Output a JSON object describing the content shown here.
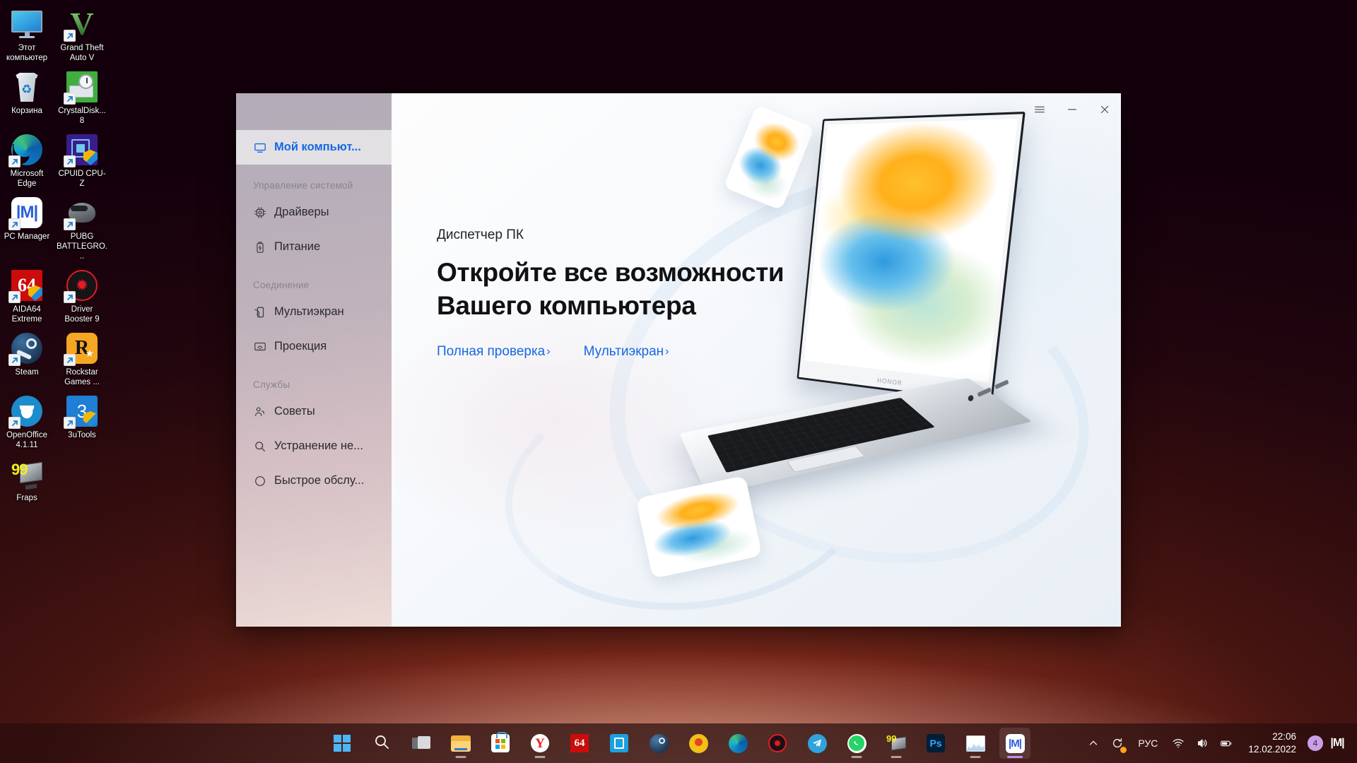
{
  "desktop": {
    "icons": [
      {
        "label": "Этот компьютер",
        "icon": "this-pc-icon",
        "shortcut": false,
        "art": "monitor"
      },
      {
        "label": "Grand Theft Auto V",
        "icon": "gta-v-icon",
        "shortcut": true,
        "art": "gtav"
      },
      {
        "label": "Корзина",
        "icon": "recycle-bin-icon",
        "shortcut": false,
        "art": "bin"
      },
      {
        "label": "CrystalDisk... 8",
        "icon": "crystaldiskmark-icon",
        "shortcut": true,
        "art": "crystal"
      },
      {
        "label": "Microsoft Edge",
        "icon": "microsoft-edge-icon",
        "shortcut": true,
        "art": "edge"
      },
      {
        "label": "CPUID CPU-Z",
        "icon": "cpu-z-icon",
        "shortcut": true,
        "art": "cpuz"
      },
      {
        "label": "PC Manager",
        "icon": "pc-manager-icon",
        "shortcut": true,
        "art": "pcm"
      },
      {
        "label": "PUBG BATTLEGRO...",
        "icon": "pubg-icon",
        "shortcut": true,
        "art": "pubg"
      },
      {
        "label": "AIDA64 Extreme",
        "icon": "aida64-icon",
        "shortcut": true,
        "art": "aida"
      },
      {
        "label": "Driver Booster 9",
        "icon": "driver-booster-icon",
        "shortcut": true,
        "art": "driver"
      },
      {
        "label": "Steam",
        "icon": "steam-icon",
        "shortcut": true,
        "art": "steam"
      },
      {
        "label": "Rockstar Games ...",
        "icon": "rockstar-games-icon",
        "shortcut": true,
        "art": "rockstar"
      },
      {
        "label": "OpenOffice 4.1.11",
        "icon": "openoffice-icon",
        "shortcut": true,
        "art": "openoffice"
      },
      {
        "label": "3uTools",
        "icon": "3utools-icon",
        "shortcut": true,
        "art": "3utools"
      },
      {
        "label": "Fraps",
        "icon": "fraps-icon",
        "shortcut": false,
        "art": "fraps"
      }
    ]
  },
  "window": {
    "title_controls": {
      "menu_label": "Меню",
      "minimize_label": "Свернуть",
      "close_label": "Закрыть"
    },
    "sidebar": {
      "primary": {
        "label": "Мой компьют...",
        "icon": "monitor-icon",
        "active": true
      },
      "sections": [
        {
          "title": "Управление системой",
          "items": [
            {
              "label": "Драйверы",
              "icon": "chip-icon"
            },
            {
              "label": "Питание",
              "icon": "battery-icon"
            }
          ]
        },
        {
          "title": "Соединение",
          "items": [
            {
              "label": "Мультиэкран",
              "icon": "multiscreen-icon"
            },
            {
              "label": "Проекция",
              "icon": "projection-icon"
            }
          ]
        },
        {
          "title": "Службы",
          "items": [
            {
              "label": "Советы",
              "icon": "tips-icon"
            },
            {
              "label": "Устранение не...",
              "icon": "search-icon"
            },
            {
              "label": "Быстрое обслу...",
              "icon": "shield-icon"
            }
          ]
        }
      ]
    },
    "hero": {
      "eyebrow": "Диспетчер ПК",
      "headline_line1": "Откройте все возможности",
      "headline_line2": "Вашего компьютера",
      "links": [
        {
          "label": "Полная проверка",
          "chevron": "›"
        },
        {
          "label": "Мультиэкран",
          "chevron": "›"
        }
      ]
    },
    "accent_color": "#1668e3"
  },
  "taskbar": {
    "items": [
      {
        "name": "start-button",
        "art": "win",
        "running": false,
        "focused": false
      },
      {
        "name": "search-button",
        "art": "search",
        "running": false,
        "focused": false
      },
      {
        "name": "task-view-button",
        "art": "taskview",
        "running": false,
        "focused": false
      },
      {
        "name": "file-explorer",
        "art": "folder",
        "running": true,
        "focused": false
      },
      {
        "name": "microsoft-store",
        "art": "store",
        "running": false,
        "focused": false
      },
      {
        "name": "yandex-browser",
        "art": "yandex",
        "running": true,
        "focused": false
      },
      {
        "name": "aida64",
        "art": "aida",
        "running": false,
        "focused": false
      },
      {
        "name": "clipboard-app",
        "art": "blue",
        "running": false,
        "focused": false
      },
      {
        "name": "steam",
        "art": "steam",
        "running": false,
        "focused": false
      },
      {
        "name": "music-player",
        "art": "music",
        "running": false,
        "focused": false
      },
      {
        "name": "microsoft-edge",
        "art": "edge",
        "running": false,
        "focused": false
      },
      {
        "name": "driver-booster",
        "art": "driver",
        "running": false,
        "focused": false
      },
      {
        "name": "telegram",
        "art": "telegram",
        "running": false,
        "focused": false
      },
      {
        "name": "whatsapp",
        "art": "whatsapp",
        "running": true,
        "focused": false
      },
      {
        "name": "fraps",
        "art": "fraps",
        "running": true,
        "focused": false
      },
      {
        "name": "photoshop",
        "art": "photoshop",
        "running": false,
        "focused": false
      },
      {
        "name": "hwmonitor",
        "art": "chart",
        "running": true,
        "focused": false
      },
      {
        "name": "pc-manager",
        "art": "pcm",
        "running": true,
        "focused": true
      }
    ],
    "tray": {
      "chevron_icon": "chevron-up-icon",
      "update_icon": "update-icon",
      "language": "РУС",
      "wifi_icon": "wifi-icon",
      "volume_icon": "volume-icon",
      "battery_icon": "battery-icon",
      "time": "22:06",
      "date": "12.02.2022",
      "notification_count": "4",
      "pc_manager_icon": "pc-manager-tray-icon"
    }
  }
}
